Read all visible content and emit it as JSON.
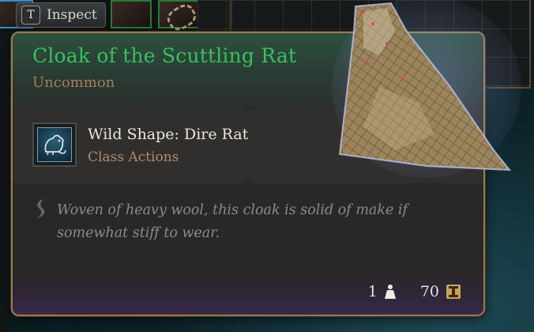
{
  "inventory": {
    "inspect_key": "T",
    "inspect_label": "Inspect"
  },
  "tooltip": {
    "item_name": "Cloak of the Scuttling Rat",
    "rarity": "Uncommon",
    "action": {
      "name": "Wild Shape: Dire Rat",
      "category": "Class Actions",
      "icon": "rat-icon"
    },
    "description": "Woven of heavy wool, this cloak is solid of make if somewhat stiff to wear.",
    "weight": "1",
    "weight_icon": "weight-icon",
    "value": "70",
    "value_icon": "gold-icon",
    "colors": {
      "item_name": "#36c15e",
      "rarity": "#a47f5a",
      "border": "#9b7d4a",
      "category": "#b48a64"
    }
  }
}
